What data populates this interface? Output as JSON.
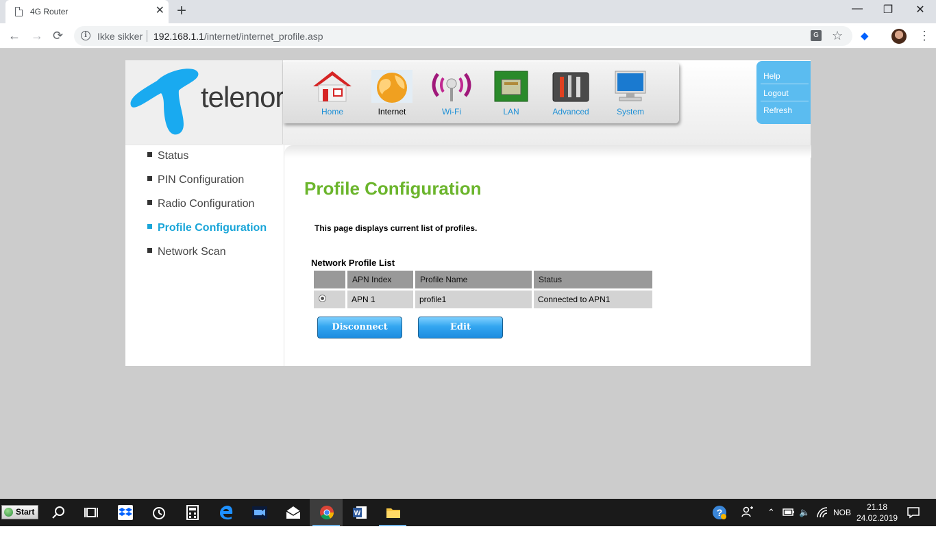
{
  "browser": {
    "tab_title": "4G Router",
    "tab_close": "✕",
    "new_tab": "+",
    "win_min": "—",
    "win_restore": "❐",
    "win_close": "✕",
    "back": "←",
    "forward": "→",
    "reload": "⟳",
    "security_label": "Ikke sikker",
    "url_host": "192.168.1.1",
    "url_path": "/internet/internet_profile.asp",
    "bookmark_star": "☆",
    "menu": "⋮"
  },
  "router": {
    "brand": "telenor",
    "nav": [
      {
        "label": "Home",
        "icon": "house-icon"
      },
      {
        "label": "Internet",
        "icon": "globe-icon",
        "active": true
      },
      {
        "label": "Wi-Fi",
        "icon": "wifi-icon"
      },
      {
        "label": "LAN",
        "icon": "lan-port-icon"
      },
      {
        "label": "Advanced",
        "icon": "toolbox-icon"
      },
      {
        "label": "System",
        "icon": "monitor-icon"
      }
    ],
    "help_links": [
      "Help",
      "Logout",
      "Refresh"
    ],
    "sidebar": [
      {
        "label": "Status"
      },
      {
        "label": "PIN Configuration"
      },
      {
        "label": "Radio Configuration"
      },
      {
        "label": "Profile Configuration",
        "active": true
      },
      {
        "label": "Network Scan"
      }
    ],
    "page_title": "Profile Configuration",
    "description": "This page displays current list of profiles.",
    "list_title": "Network Profile List",
    "table": {
      "headers": [
        "",
        "APN Index",
        "Profile Name",
        "Status"
      ],
      "rows": [
        {
          "apn_index": "APN 1",
          "profile_name": "profile1",
          "status": "Connected to APN1",
          "selected": true
        }
      ]
    },
    "buttons": {
      "disconnect": "Disconnect",
      "edit": "Edit"
    },
    "colors": {
      "accent_blue": "#1e90d6",
      "title_green": "#6bb52c",
      "help_blue": "#5bbcf0"
    }
  },
  "taskbar": {
    "start_label": "Start",
    "language": "NOB",
    "time": "21.18",
    "date": "24.02.2019"
  }
}
